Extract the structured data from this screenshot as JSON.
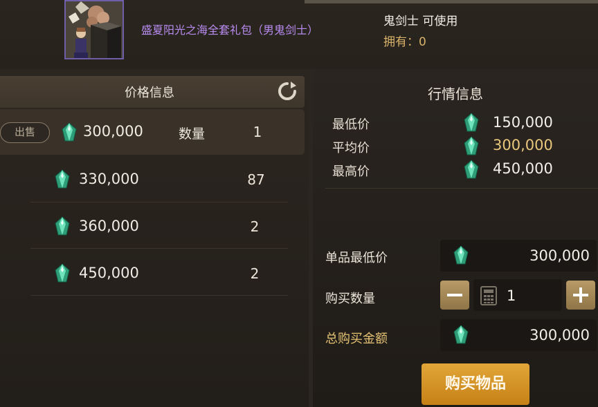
{
  "item": {
    "name": "盛夏阳光之海全套礼包（男鬼剑士）",
    "usable": "鬼剑士 可使用",
    "owned": "拥有：0"
  },
  "price_panel": {
    "title": "价格信息",
    "refresh_icon": "refresh-icon",
    "sell_label": "出售",
    "quantity_label": "数量",
    "currency_icon": "gem-icon",
    "listings": [
      {
        "price": "300,000",
        "quantity": "1"
      },
      {
        "price": "330,000",
        "quantity": "87"
      },
      {
        "price": "360,000",
        "quantity": "2"
      },
      {
        "price": "450,000",
        "quantity": "2"
      }
    ]
  },
  "market_panel": {
    "title": "行情信息",
    "rows": [
      {
        "label": "最低价",
        "value": "150,000"
      },
      {
        "label": "平均价",
        "value": "300,000"
      },
      {
        "label": "最高价",
        "value": "450,000"
      }
    ],
    "colors": {
      "normal": "#f2efe8",
      "average": "#e8c77d"
    }
  },
  "purchase": {
    "unit_min_price_label": "单品最低价",
    "unit_min_price": "300,000",
    "quantity_label": "购买数量",
    "quantity": "1",
    "minus_icon": "minus-icon",
    "plus_icon": "plus-icon",
    "calculator_icon": "calculator-icon",
    "total_label": "总购买金额",
    "total": "300,000",
    "buy_button": "购买物品"
  },
  "colors": {
    "item_name": "#b88cf0",
    "owned": "#d9b36a",
    "buy_button": "#d9921f",
    "gem": "#3fc79a"
  }
}
